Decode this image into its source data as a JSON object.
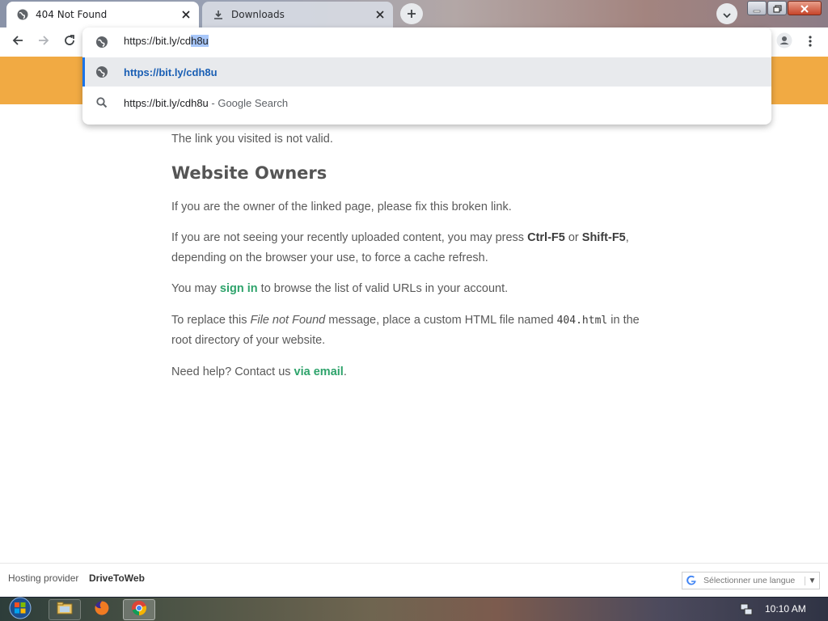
{
  "tabs": [
    {
      "label": "404 Not Found",
      "icon": "globe-icon",
      "active": true
    },
    {
      "label": "Downloads",
      "icon": "download-icon",
      "active": false
    }
  ],
  "omnibox": {
    "input_prefix": "https://bit.ly/cd",
    "input_selected": "h8u",
    "suggestions": [
      {
        "text": "https://bit.ly/cdh8u",
        "description": "",
        "icon": "globe-icon"
      },
      {
        "text": "https://bit.ly/cdh8u",
        "description": " - Google Search",
        "icon": "search-icon"
      }
    ]
  },
  "page": {
    "intro": "The link you visited is not valid.",
    "owners_heading": "Website Owners",
    "p1": "If you are the owner of the linked page, please fix this broken link.",
    "p2": {
      "before": "If you are not seeing your recently uploaded content, you may press ",
      "key1": "Ctrl-F5",
      "mid": " or ",
      "key2": "Shift-F5",
      "after": ", depending on the browser your use, to force a cache refresh."
    },
    "p3": {
      "before": "You may ",
      "link": "sign in",
      "after": " to browse the list of valid URLs in your account."
    },
    "p4": {
      "before": "To replace this ",
      "em": "File not Found",
      "mid": " message, place a custom HTML file named ",
      "code": "404.html",
      "after": " in the root directory of your website."
    },
    "p5": {
      "before": "Need help? Contact us ",
      "link": "via email",
      "after": "."
    }
  },
  "footer": {
    "hosting_label": "Hosting provider",
    "hosting_name": "DriveToWeb",
    "language_select": "Sélectionner une langue"
  },
  "taskbar": {
    "clock": "10:10 AM"
  },
  "colors": {
    "banner": "#f1aa43",
    "link": "#2ea36b",
    "omnibox_highlight": "#1a73e8"
  }
}
